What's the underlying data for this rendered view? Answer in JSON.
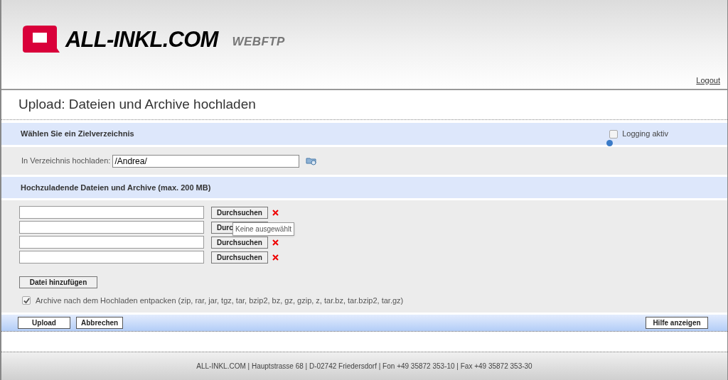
{
  "header": {
    "brand": "ALL-INKL.COM",
    "product": "WEBFTP",
    "logout": "Logout"
  },
  "page_title": "Upload: Dateien und Archive hochladen",
  "target_section": {
    "heading": "Wählen Sie ein Zielverzeichnis",
    "logging": {
      "label": "Logging aktiv",
      "checked": false
    },
    "field_label": "In Verzeichnis hochladen:",
    "field_value": "/Andrea/"
  },
  "files_section": {
    "heading": "Hochzuladende Dateien und Archive (max. 200 MB)",
    "rows": [
      {
        "button": "Durchsuchen",
        "remove_visible": true
      },
      {
        "button": "Durc",
        "remove_visible": false
      },
      {
        "button": "Durchsuchen",
        "remove_visible": true
      },
      {
        "button": "Durchsuchen",
        "remove_visible": true
      }
    ],
    "tooltip": "Keine ausgewählt",
    "add_button": "Datei hinzufügen",
    "extract": {
      "label": "Archive nach dem Hochladen entpacken (zip, rar, jar, tgz, tar, bzip2, bz, gz, gzip, z, tar.bz, tar.bzip2, tar.gz)",
      "checked": true
    }
  },
  "actions": {
    "left": [
      "Upload",
      "Abbrechen"
    ],
    "right": "Hilfe anzeigen"
  },
  "footer": "ALL-INKL.COM | Hauptstrasse 68 | D-02742 Friedersdorf | Fon +49 35872 353-10 | Fax +49 35872 353-30"
}
